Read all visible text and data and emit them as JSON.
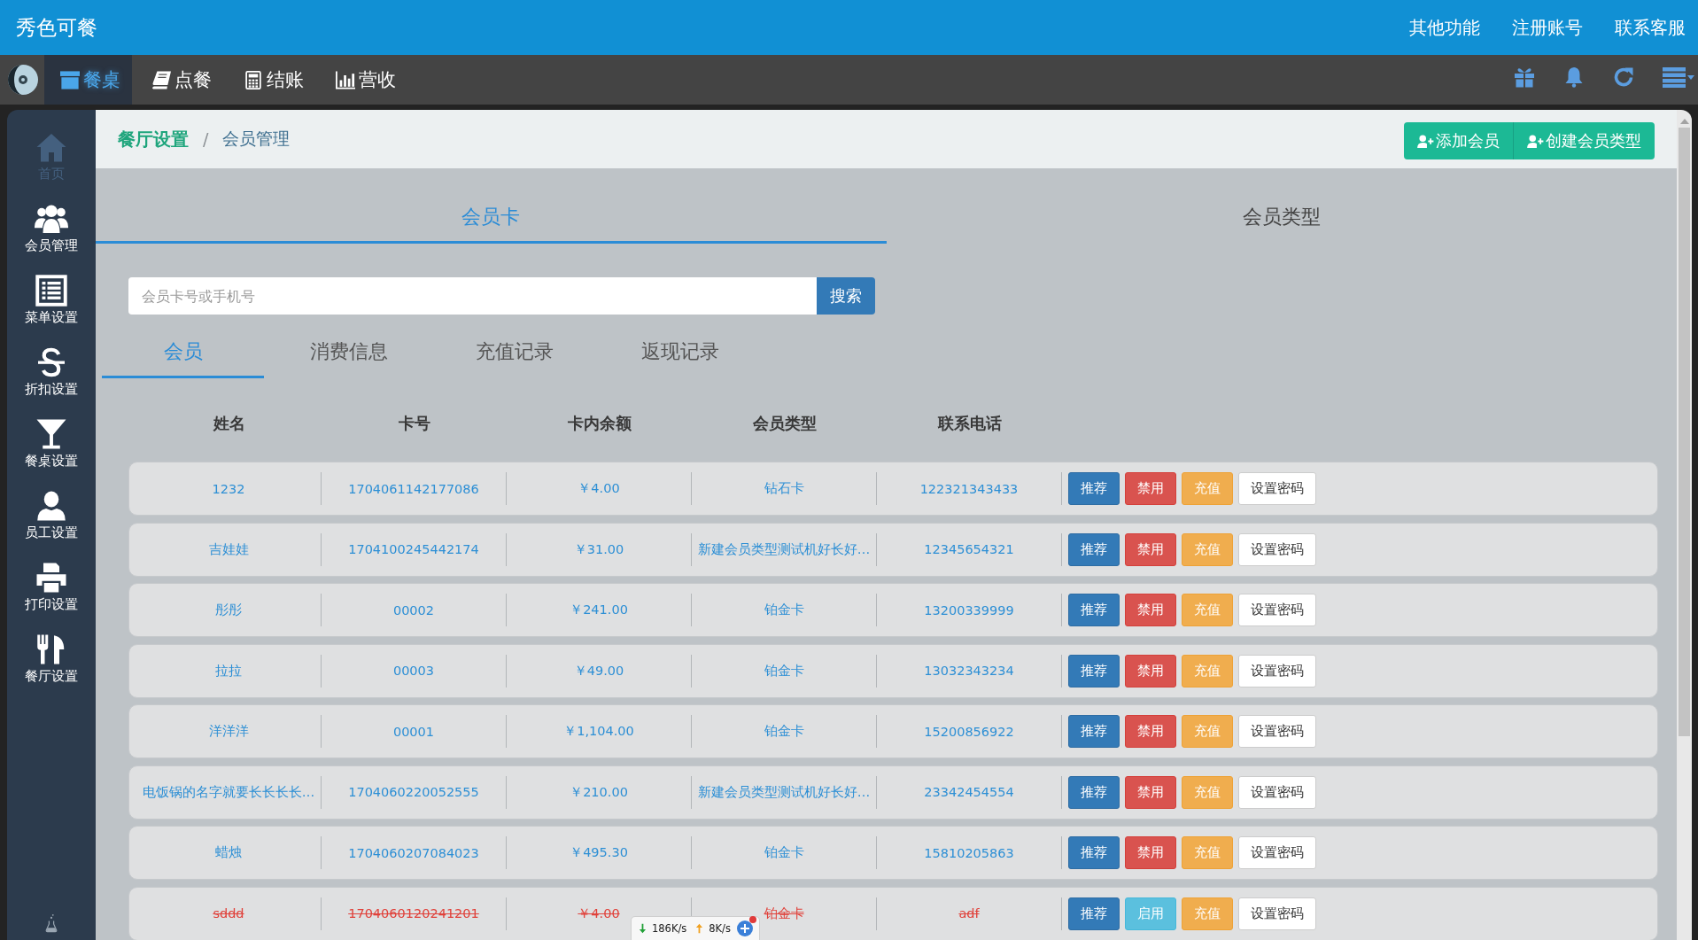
{
  "app_bar": {
    "title": "秀色可餐",
    "links": [
      "其他功能",
      "注册账号",
      "联系客服"
    ]
  },
  "nav": {
    "tabs": [
      {
        "label": "餐桌",
        "selected": true
      },
      {
        "label": "点餐",
        "selected": false
      },
      {
        "label": "结账",
        "selected": false
      },
      {
        "label": "营收",
        "selected": false
      }
    ]
  },
  "sidebar": {
    "items": [
      {
        "label": "首页",
        "disabled": true
      },
      {
        "label": "会员管理",
        "disabled": false
      },
      {
        "label": "菜单设置",
        "disabled": false
      },
      {
        "label": "折扣设置",
        "disabled": false
      },
      {
        "label": "餐桌设置",
        "disabled": false
      },
      {
        "label": "员工设置",
        "disabled": false
      },
      {
        "label": "打印设置",
        "disabled": false
      },
      {
        "label": "餐厅设置",
        "disabled": false
      }
    ]
  },
  "breadcrumb": {
    "parent": "餐厅设置",
    "separator": "/",
    "current": "会员管理"
  },
  "actions": [
    "添加会员",
    "创建会员类型"
  ],
  "card_tabs": [
    {
      "label": "会员卡",
      "selected": true
    },
    {
      "label": "会员类型",
      "selected": false
    }
  ],
  "search": {
    "placeholder": "会员卡号或手机号",
    "button": "搜索"
  },
  "record_tabs": [
    {
      "label": "会员",
      "selected": true
    },
    {
      "label": "消费信息",
      "selected": false
    },
    {
      "label": "充值记录",
      "selected": false
    },
    {
      "label": "返现记录",
      "selected": false
    }
  ],
  "table": {
    "columns": [
      "姓名",
      "卡号",
      "卡内余额",
      "会员类型",
      "联系电话"
    ],
    "rows": [
      {
        "cells": [
          "1232",
          "1704061142177086",
          "￥4.00",
          "钻石卡",
          "122321343433"
        ],
        "disabled": false,
        "actions": [
          {
            "kind": "recommend",
            "label": "推荐"
          },
          {
            "kind": "toggle",
            "label": "禁用"
          },
          {
            "kind": "recharge",
            "label": "充值"
          },
          {
            "kind": "password",
            "label": "设置密码"
          }
        ]
      },
      {
        "cells": [
          "吉娃娃",
          "1704100245442174",
          "￥31.00",
          "新建会员类型测试机好长好…",
          "12345654321"
        ],
        "disabled": false,
        "actions": [
          {
            "kind": "recommend",
            "label": "推荐"
          },
          {
            "kind": "toggle",
            "label": "禁用"
          },
          {
            "kind": "recharge",
            "label": "充值"
          },
          {
            "kind": "password",
            "label": "设置密码"
          }
        ]
      },
      {
        "cells": [
          "彤彤",
          "00002",
          "￥241.00",
          "铂金卡",
          "13200339999"
        ],
        "disabled": false,
        "actions": [
          {
            "kind": "recommend",
            "label": "推荐"
          },
          {
            "kind": "toggle",
            "label": "禁用"
          },
          {
            "kind": "recharge",
            "label": "充值"
          },
          {
            "kind": "password",
            "label": "设置密码"
          }
        ]
      },
      {
        "cells": [
          "拉拉",
          "00003",
          "￥49.00",
          "铂金卡",
          "13032343234"
        ],
        "disabled": false,
        "actions": [
          {
            "kind": "recommend",
            "label": "推荐"
          },
          {
            "kind": "toggle",
            "label": "禁用"
          },
          {
            "kind": "recharge",
            "label": "充值"
          },
          {
            "kind": "password",
            "label": "设置密码"
          }
        ]
      },
      {
        "cells": [
          "洋洋洋",
          "00001",
          "￥1,104.00",
          "铂金卡",
          "15200856922"
        ],
        "disabled": false,
        "actions": [
          {
            "kind": "recommend",
            "label": "推荐"
          },
          {
            "kind": "toggle",
            "label": "禁用"
          },
          {
            "kind": "recharge",
            "label": "充值"
          },
          {
            "kind": "password",
            "label": "设置密码"
          }
        ]
      },
      {
        "cells": [
          "电饭锅的名字就要长长长长…",
          "1704060220052555",
          "￥210.00",
          "新建会员类型测试机好长好…",
          "23342454554"
        ],
        "disabled": false,
        "actions": [
          {
            "kind": "recommend",
            "label": "推荐"
          },
          {
            "kind": "toggle",
            "label": "禁用"
          },
          {
            "kind": "recharge",
            "label": "充值"
          },
          {
            "kind": "password",
            "label": "设置密码"
          }
        ]
      },
      {
        "cells": [
          "蜡烛",
          "1704060207084023",
          "￥495.30",
          "铂金卡",
          "15810205863"
        ],
        "disabled": false,
        "actions": [
          {
            "kind": "recommend",
            "label": "推荐"
          },
          {
            "kind": "toggle",
            "label": "禁用"
          },
          {
            "kind": "recharge",
            "label": "充值"
          },
          {
            "kind": "password",
            "label": "设置密码"
          }
        ]
      },
      {
        "cells": [
          "sddd",
          "1704060120241201",
          "￥4.00",
          "铂金卡",
          "adf"
        ],
        "disabled": true,
        "actions": [
          {
            "kind": "recommend",
            "label": "推荐"
          },
          {
            "kind": "toggle",
            "label": "启用"
          },
          {
            "kind": "recharge",
            "label": "充值"
          },
          {
            "kind": "password",
            "label": "设置密码"
          }
        ]
      }
    ]
  },
  "speed_meter": {
    "download": "186K/s",
    "upload": "8K/s"
  }
}
